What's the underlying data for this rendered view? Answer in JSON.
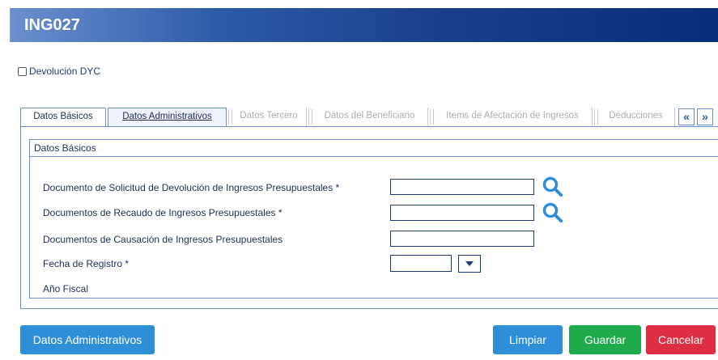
{
  "window": {
    "title": "ING027"
  },
  "devolucion": {
    "label": "Devolución DYC",
    "checked": false
  },
  "tabs": [
    {
      "label": "Datos Básicos",
      "state": "active"
    },
    {
      "label": "Datos Administrativos",
      "state": "enabled"
    },
    {
      "label": "Datos Tercero",
      "state": "disabled"
    },
    {
      "label": "Datos del Beneficiario",
      "state": "disabled"
    },
    {
      "label": "Items de Afectación de Ingresos",
      "state": "disabled"
    },
    {
      "label": "Deducciones",
      "state": "disabled"
    }
  ],
  "tab_nav": {
    "prev": "«",
    "next": "»"
  },
  "section": {
    "title": "Datos Básicos",
    "fields": [
      {
        "label": "Documento de Solicitud de Devolución de Ingresos Presupuestales *",
        "value": "",
        "has_search": true
      },
      {
        "label": "Documentos de Recaudo de Ingresos Presupuestales *",
        "value": "",
        "has_search": true
      },
      {
        "label": "Documentos de Causación de Ingresos Presupuestales",
        "value": "",
        "has_search": false
      },
      {
        "label": "Fecha de Registro *",
        "value": "",
        "type": "date"
      },
      {
        "label": "Año Fiscal",
        "value": ""
      }
    ]
  },
  "buttons": {
    "datos_administrativos": "Datos Administrativos",
    "limpiar": "Limpiar",
    "guardar": "Guardar",
    "cancelar": "Cancelar"
  },
  "colors": {
    "title_bar": "#1a3f8e",
    "border": "#6b8fcf",
    "btn_blue": "#2e8fd8",
    "btn_green": "#1faa4b",
    "btn_red": "#dd2e44"
  }
}
